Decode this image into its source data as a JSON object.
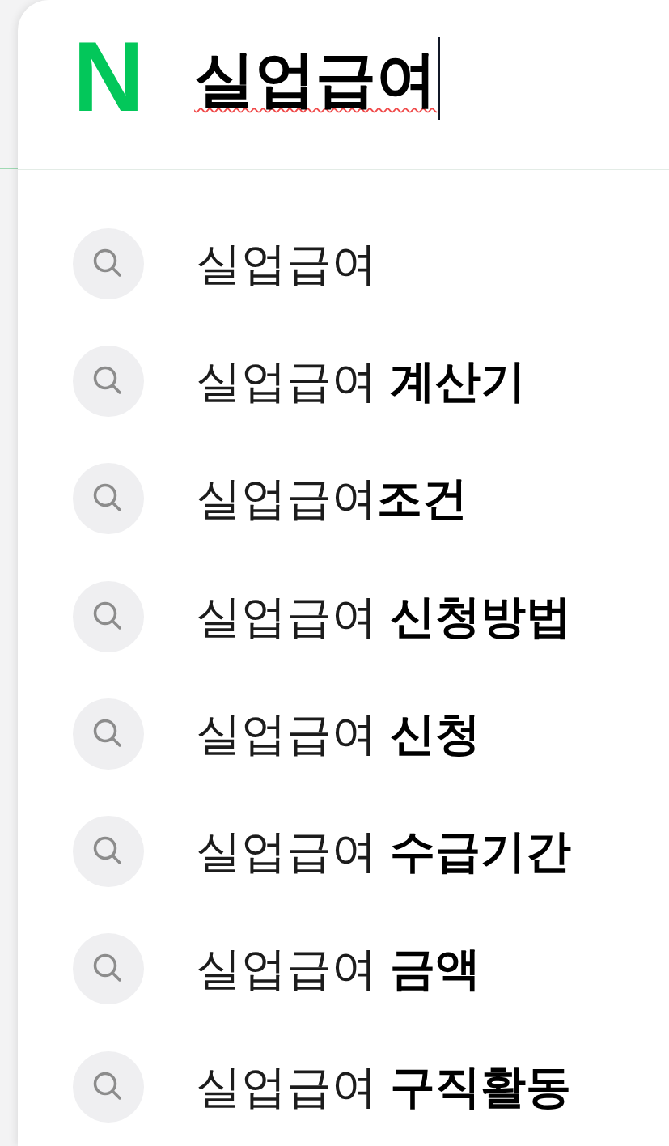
{
  "search": {
    "logo": "N",
    "query": "실업급여",
    "spelling_error": true,
    "focused": true
  },
  "suggestions": [
    {
      "text": "실업급여"
    },
    {
      "text": "실업급여 **계산기**"
    },
    {
      "text": "실업급여**조건**"
    },
    {
      "text": "실업급여 **신청방법**"
    },
    {
      "text": "실업급여 **신청**"
    },
    {
      "text": "실업급여 **수급기간**"
    },
    {
      "text": "실업급여 **금액**"
    },
    {
      "text": "실업급여 **구직활동**"
    }
  ]
}
